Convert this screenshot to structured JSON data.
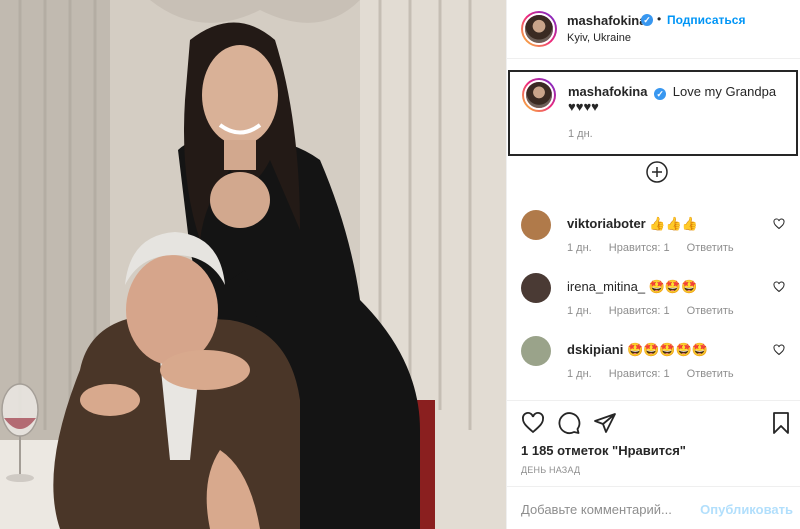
{
  "post": {
    "username": "mashafokina",
    "follow_label": "Подписаться",
    "dot": "•",
    "location": "Kyiv, Ukraine",
    "caption": "Love my Grandpa",
    "caption_hearts": "♥♥♥♥",
    "caption_time": "1 дн."
  },
  "comments": [
    {
      "username": "viktoriaboter",
      "text": "👍👍👍",
      "time": "1 дн.",
      "likes": "Нравится: 1",
      "reply": "Ответить"
    },
    {
      "username": "irena_mitina_",
      "text": "🤩🤩🤩",
      "time": "1 дн.",
      "likes": "Нравится: 1",
      "reply": "Ответить"
    },
    {
      "username": "dskipiani",
      "text": "🤩🤩🤩🤩🤩",
      "time": "1 дн.",
      "likes": "Нравится: 1",
      "reply": "Ответить"
    }
  ],
  "stats": {
    "likes_text": "1 185 отметок \"Нравится\"",
    "age_text": "ДЕНЬ НАЗАД"
  },
  "add_comment": {
    "placeholder": "Добавьте комментарий...",
    "publish_label": "Опубликовать"
  },
  "icons": {
    "like": "heart-icon",
    "comment": "comment-icon",
    "share": "paper-plane-icon",
    "save": "bookmark-icon",
    "more": "plus-circle-icon"
  },
  "colors": {
    "accent": "#0095f6",
    "publish_disabled": "#b2dffc",
    "verified": "#3897f0"
  }
}
